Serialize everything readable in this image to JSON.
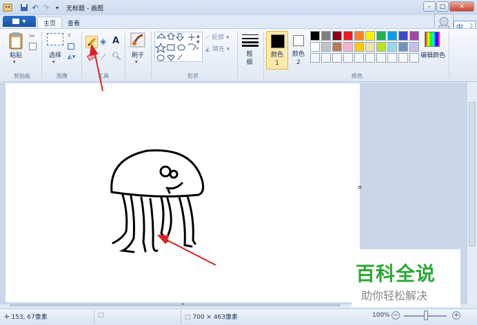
{
  "window": {
    "title": "无标题 - 画图"
  },
  "tabs": {
    "file": "▾",
    "home": "主页",
    "view": "查看"
  },
  "ribbon": {
    "clipboard": {
      "paste": "粘贴",
      "label": "剪贴板"
    },
    "image": {
      "select": "选择",
      "label": "图像"
    },
    "tools": {
      "label": "工具"
    },
    "brushes": {
      "label": "刷子"
    },
    "shapes": {
      "outline": "轮廓",
      "fill": "填充",
      "label": "形状"
    },
    "size": {
      "label": "粗细"
    },
    "colors": {
      "color1": "颜色 1",
      "color2": "颜色 2",
      "edit": "编辑颜色",
      "label": "颜色",
      "palette_row1": [
        "#000000",
        "#7f7f7f",
        "#880015",
        "#ed1c24",
        "#ff7f27",
        "#fff200",
        "#22b14c",
        "#00a2e8",
        "#3f48cc",
        "#a349a4"
      ],
      "palette_row2": [
        "#ffffff",
        "#c3c3c3",
        "#b97a57",
        "#ffaec9",
        "#ffc90e",
        "#efe4b0",
        "#b5e61d",
        "#99d9ea",
        "#7092be",
        "#c8bfe7"
      ]
    }
  },
  "ime": {
    "mode": "中",
    "moon": "☽"
  },
  "status": {
    "cursor": "153, 67像素",
    "canvas_size": "700 × 463像素",
    "zoom": "100%"
  },
  "watermark": {
    "title": "百科全说",
    "subtitle": "助你轻松解决"
  }
}
